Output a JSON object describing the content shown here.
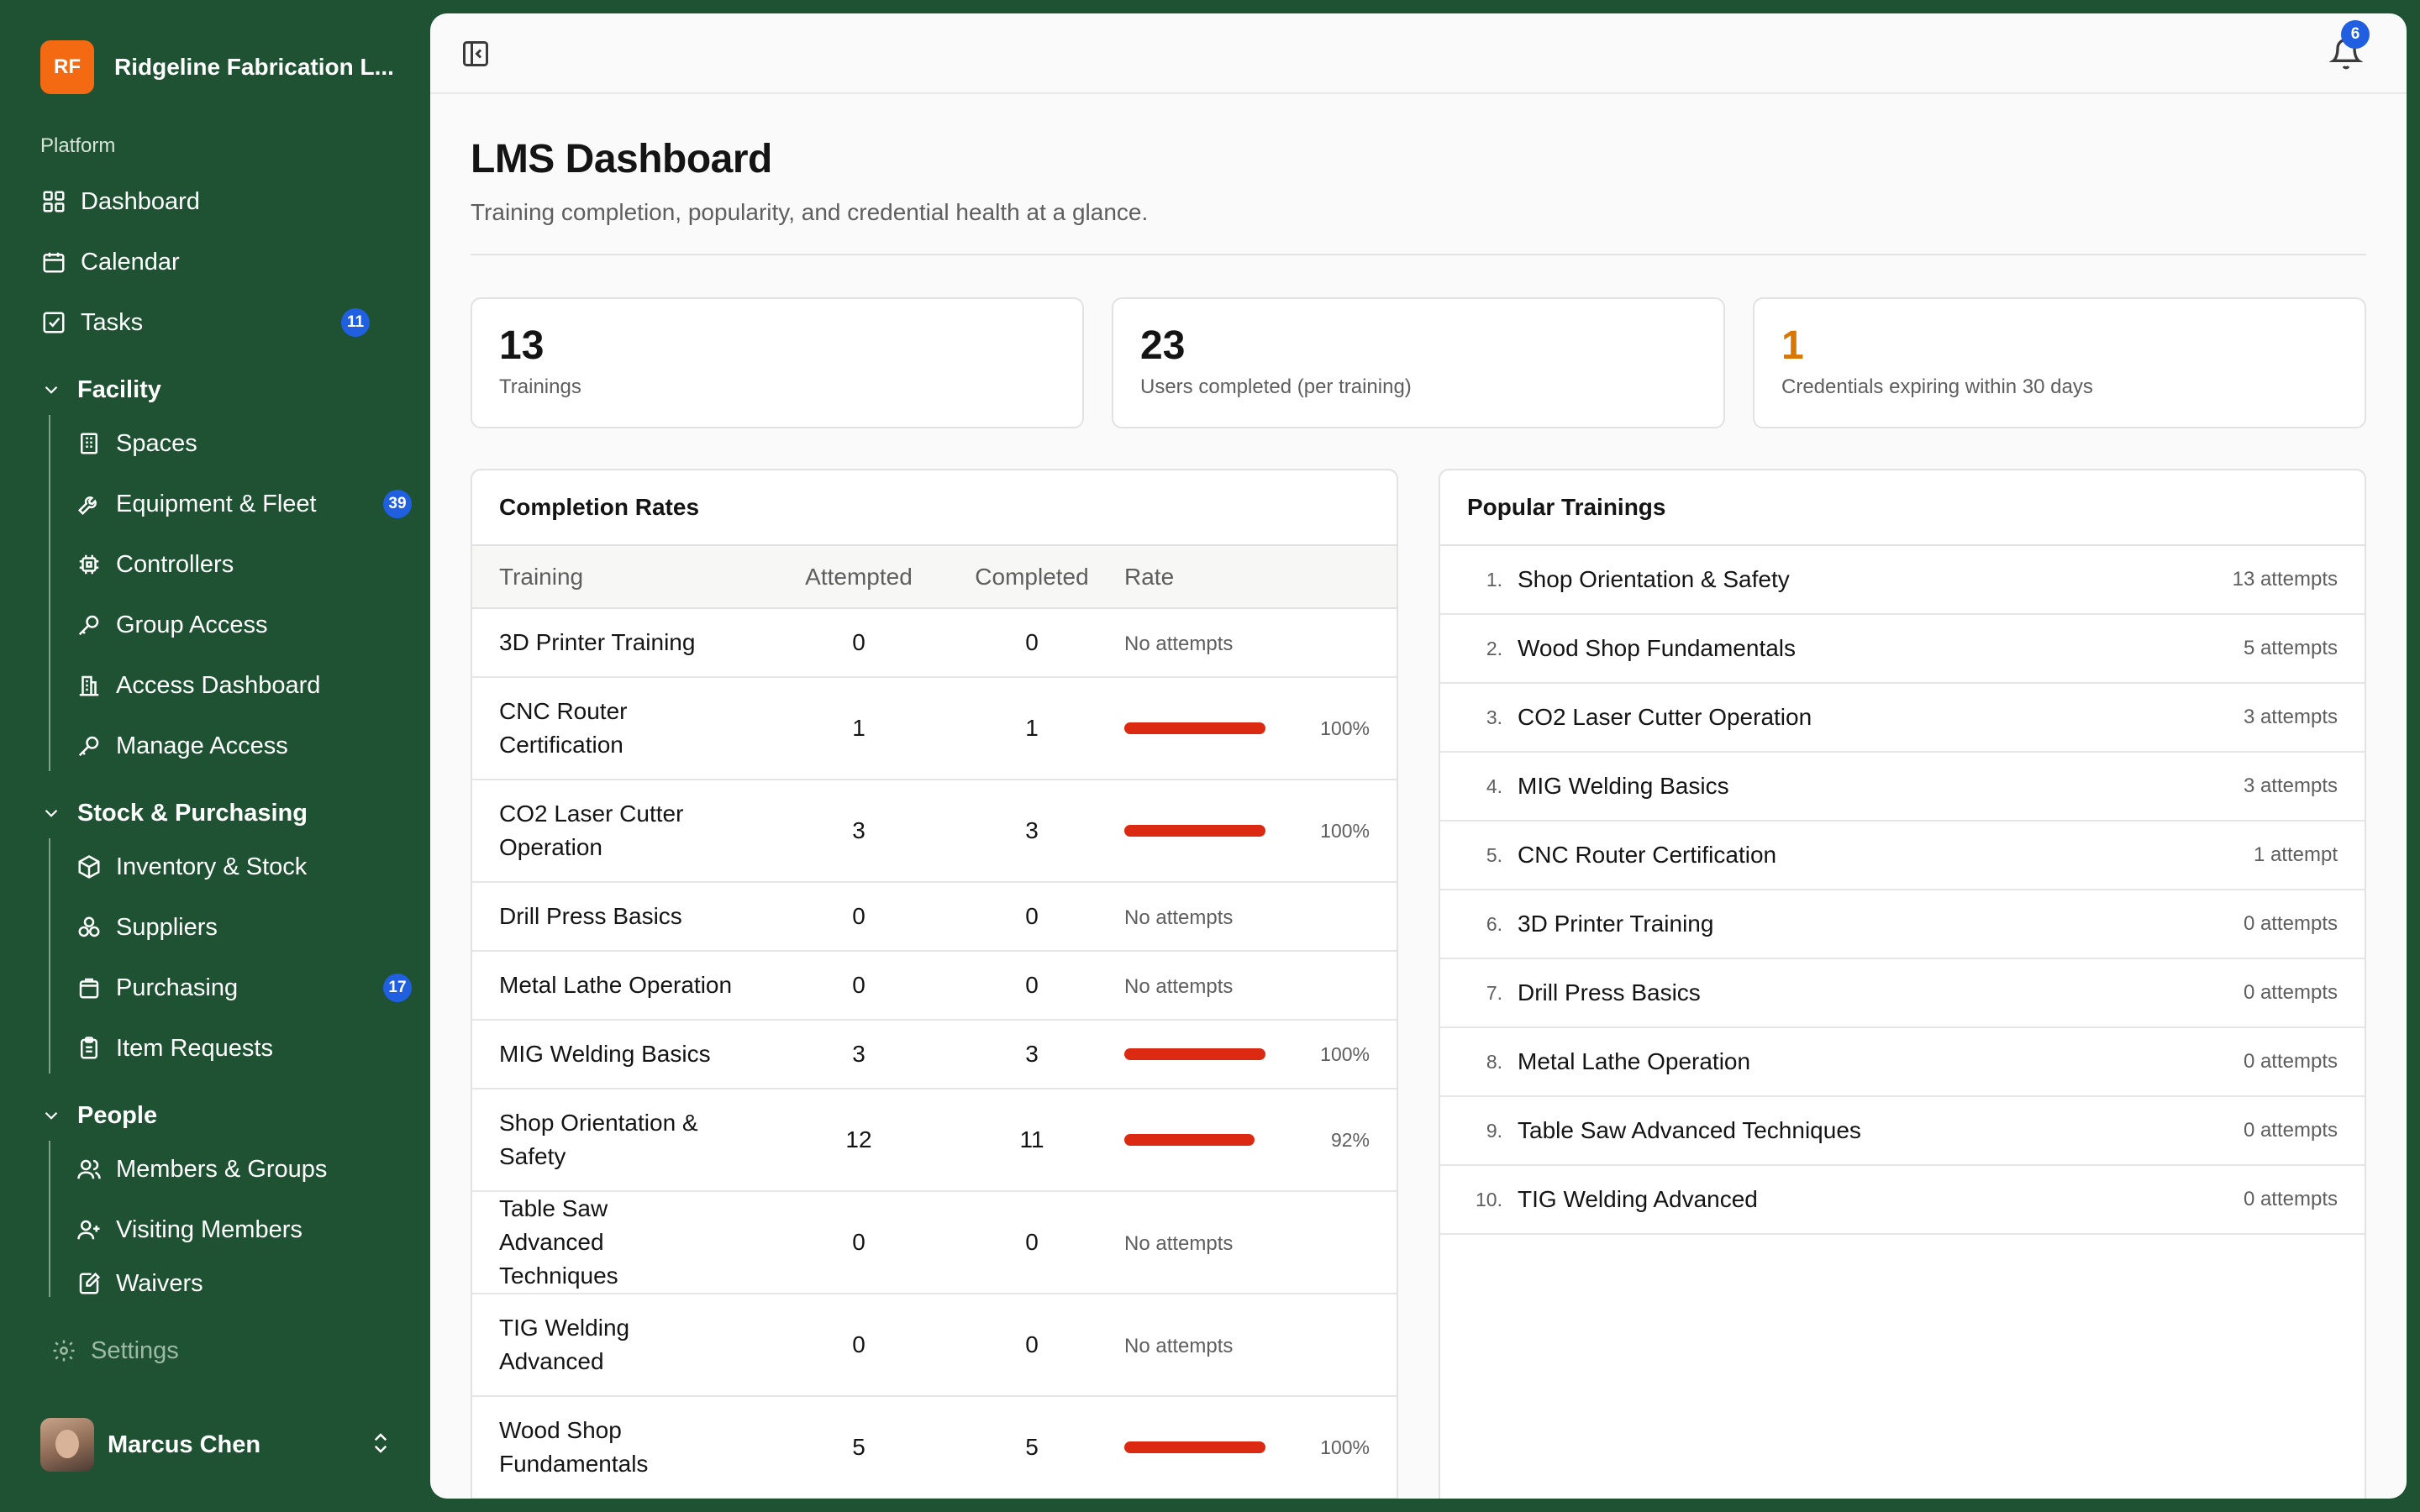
{
  "org": {
    "initials": "RF",
    "name": "Ridgeline Fabrication L..."
  },
  "sidebar": {
    "platform_label": "Platform",
    "platform_items": [
      {
        "label": "Dashboard",
        "icon": "grid-icon"
      },
      {
        "label": "Calendar",
        "icon": "calendar-icon"
      },
      {
        "label": "Tasks",
        "icon": "checkbox-icon",
        "badge": "11"
      }
    ],
    "groups": [
      {
        "label": "Facility",
        "items": [
          {
            "label": "Spaces",
            "icon": "building-icon"
          },
          {
            "label": "Equipment & Fleet",
            "icon": "wrench-icon",
            "badge": "39"
          },
          {
            "label": "Controllers",
            "icon": "chip-icon"
          },
          {
            "label": "Group Access",
            "icon": "key-icon"
          },
          {
            "label": "Access Dashboard",
            "icon": "building-icon"
          },
          {
            "label": "Manage Access",
            "icon": "key-icon"
          }
        ]
      },
      {
        "label": "Stock & Purchasing",
        "items": [
          {
            "label": "Inventory & Stock",
            "icon": "package-icon"
          },
          {
            "label": "Suppliers",
            "icon": "boxes-icon"
          },
          {
            "label": "Purchasing",
            "icon": "shopping-bag-icon",
            "badge": "17"
          },
          {
            "label": "Item Requests",
            "icon": "clipboard-icon"
          }
        ]
      },
      {
        "label": "People",
        "items": [
          {
            "label": "Members & Groups",
            "icon": "users-icon"
          },
          {
            "label": "Visiting Members",
            "icon": "user-plus-icon"
          },
          {
            "label": "Waivers",
            "icon": "signature-icon"
          }
        ]
      }
    ],
    "settings_label": "Settings",
    "user_name": "Marcus Chen"
  },
  "topbar": {
    "notification_count": "6"
  },
  "page": {
    "title": "LMS Dashboard",
    "subtitle": "Training completion, popularity, and credential health at a glance."
  },
  "stats": [
    {
      "value": "13",
      "label": "Trainings"
    },
    {
      "value": "23",
      "label": "Users completed (per training)"
    },
    {
      "value": "1",
      "label": "Credentials expiring within 30 days",
      "color": "#d97706"
    }
  ],
  "completion": {
    "title": "Completion Rates",
    "columns": [
      "Training",
      "Attempted",
      "Completed",
      "Rate"
    ],
    "no_attempts_label": "No attempts",
    "bar_color": "#dc2a12",
    "rows": [
      {
        "training": "3D Printer Training",
        "attempted": "0",
        "completed": "0",
        "rate": null,
        "rate_label": ""
      },
      {
        "training": "CNC Router Certification",
        "attempted": "1",
        "completed": "1",
        "rate": 100,
        "rate_label": "100%"
      },
      {
        "training": "CO2 Laser Cutter Operation",
        "attempted": "3",
        "completed": "3",
        "rate": 100,
        "rate_label": "100%"
      },
      {
        "training": "Drill Press Basics",
        "attempted": "0",
        "completed": "0",
        "rate": null,
        "rate_label": ""
      },
      {
        "training": "Metal Lathe Operation",
        "attempted": "0",
        "completed": "0",
        "rate": null,
        "rate_label": ""
      },
      {
        "training": "MIG Welding Basics",
        "attempted": "3",
        "completed": "3",
        "rate": 100,
        "rate_label": "100%"
      },
      {
        "training": "Shop Orientation & Safety",
        "attempted": "12",
        "completed": "11",
        "rate": 92,
        "rate_label": "92%"
      },
      {
        "training": "Table Saw Advanced Techniques",
        "attempted": "0",
        "completed": "0",
        "rate": null,
        "rate_label": ""
      },
      {
        "training": "TIG Welding Advanced",
        "attempted": "0",
        "completed": "0",
        "rate": null,
        "rate_label": ""
      },
      {
        "training": "Wood Shop Fundamentals",
        "attempted": "5",
        "completed": "5",
        "rate": 100,
        "rate_label": "100%"
      }
    ]
  },
  "popular": {
    "title": "Popular Trainings",
    "rows": [
      {
        "rank": "1.",
        "name": "Shop Orientation & Safety",
        "count": "13 attempts"
      },
      {
        "rank": "2.",
        "name": "Wood Shop Fundamentals",
        "count": "5 attempts"
      },
      {
        "rank": "3.",
        "name": "CO2 Laser Cutter Operation",
        "count": "3 attempts"
      },
      {
        "rank": "4.",
        "name": "MIG Welding Basics",
        "count": "3 attempts"
      },
      {
        "rank": "5.",
        "name": "CNC Router Certification",
        "count": "1 attempt"
      },
      {
        "rank": "6.",
        "name": "3D Printer Training",
        "count": "0 attempts"
      },
      {
        "rank": "7.",
        "name": "Drill Press Basics",
        "count": "0 attempts"
      },
      {
        "rank": "8.",
        "name": "Metal Lathe Operation",
        "count": "0 attempts"
      },
      {
        "rank": "9.",
        "name": "Table Saw Advanced Techniques",
        "count": "0 attempts"
      },
      {
        "rank": "10.",
        "name": "TIG Welding Advanced",
        "count": "0 attempts"
      }
    ]
  }
}
